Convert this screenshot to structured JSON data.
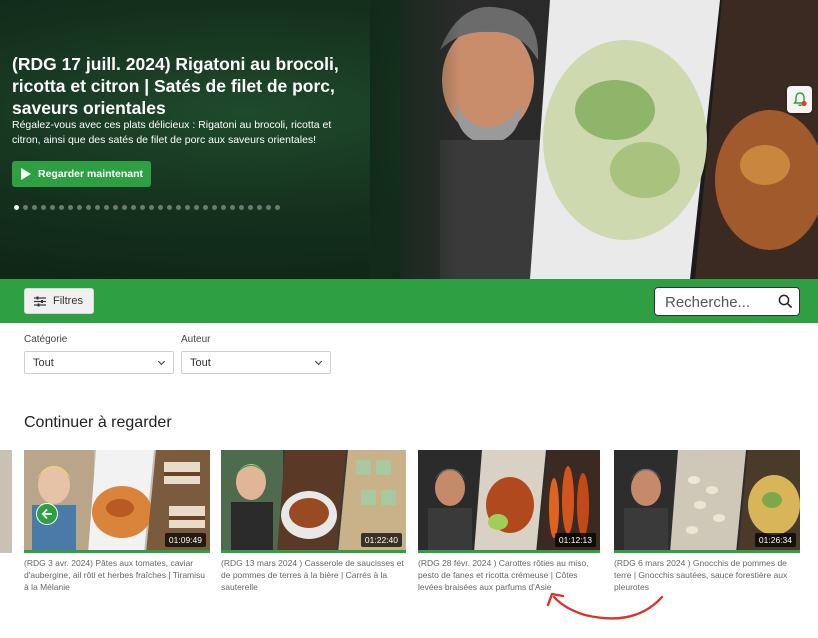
{
  "hero": {
    "title": "(RDG 17 juill. 2024) Rigatoni au brocoli, ricotta et citron | Satés de filet de porc, saveurs orientales",
    "description": "Régalez-vous avec ces plats délicieux : Rigatoni au brocoli, ricotta et citron, ainsi que des satés de filet de porc aux saveurs orientales!",
    "watch_button": "Regarder maintenant",
    "slide_count": 30,
    "active_slide": 1
  },
  "toolbar": {
    "filters_label": "Filtres",
    "search_placeholder": "Recherche..."
  },
  "filters": {
    "category_label": "Catégorie",
    "category_value": "Tout",
    "author_label": "Auteur",
    "author_value": "Tout"
  },
  "continue": {
    "title": "Continuer à regarder",
    "items": [
      {
        "caption": "(RDG 3 avr. 2024) Pâtes aux tomates, caviar d'aubergine, ail rôti et herbes fraîches | Tiramisu à la Mélanie",
        "duration": "01:09:49",
        "progress": 1.0
      },
      {
        "caption": "(RDG 13 mars 2024 ) Casserole de saucisses et de pommes de terres à la bière | Carrés à la sauterelle",
        "duration": "01:22:40",
        "progress": 1.0
      },
      {
        "caption": "(RDG 28 févr. 2024 ) Carottes rôties au miso, pesto de fanes et ricotta crémeuse | Côtes levées braisées aux parfums d'Asie",
        "duration": "01:12:13",
        "progress": 1.0
      },
      {
        "caption": "(RDG 6 mars 2024 ) Gnocchis de pommes de terre | Gnocchis sautées, sauce forestière aux pleurotes",
        "duration": "01:26:34",
        "progress": 1.0
      }
    ]
  },
  "colors": {
    "accent": "#2ea043",
    "hero_bg": "#14301d"
  }
}
